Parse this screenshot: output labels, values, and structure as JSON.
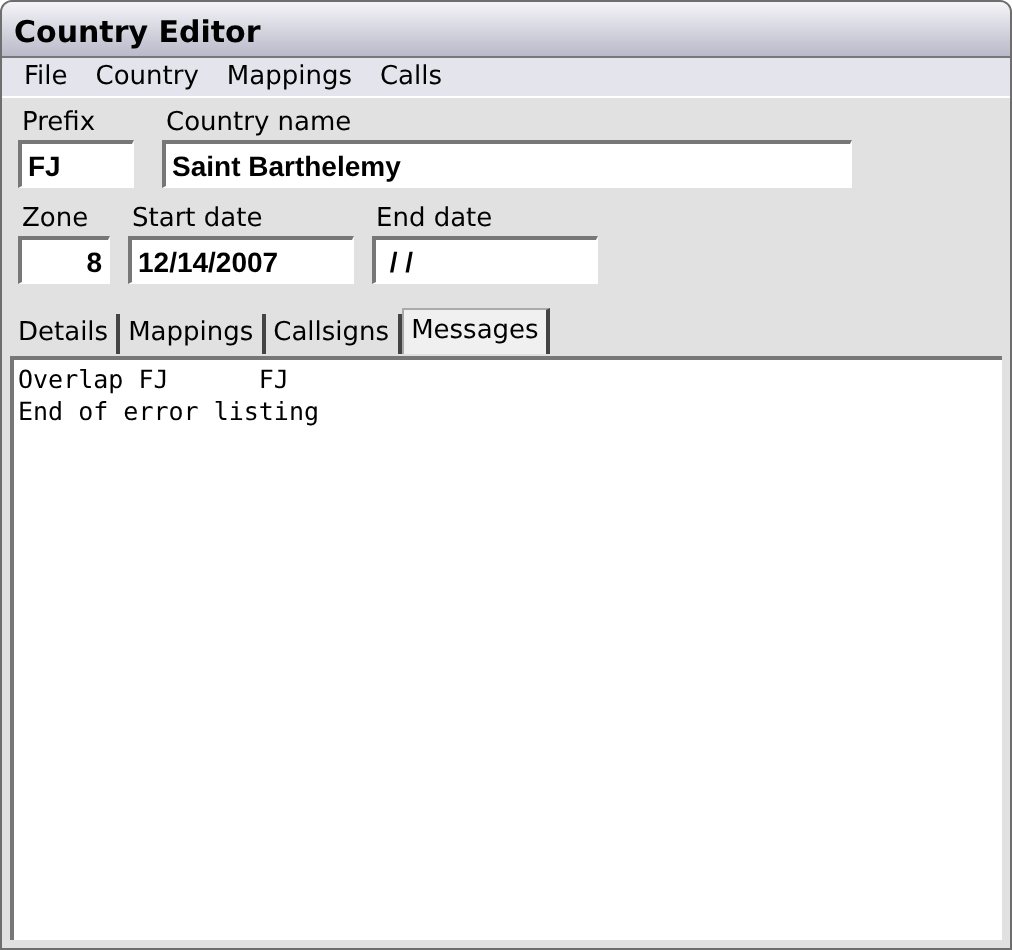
{
  "window": {
    "title": "Country Editor"
  },
  "menu": [
    "File",
    "Country",
    "Mappings",
    "Calls"
  ],
  "prefix": {
    "label": "Prefix",
    "value": "FJ"
  },
  "country_name": {
    "label": "Country name",
    "value": "Saint Barthelemy"
  },
  "zone": {
    "label": "Zone",
    "value": "8"
  },
  "start_date": {
    "label": "Start date",
    "value": "12/14/2007"
  },
  "end_date": {
    "label": "End date",
    "value": " / /"
  },
  "tabs": [
    {
      "label": "Details",
      "selected": false
    },
    {
      "label": "Mappings",
      "selected": false
    },
    {
      "label": "Callsigns",
      "selected": false
    },
    {
      "label": "Messages",
      "selected": true
    }
  ],
  "messages": [
    "Overlap FJ      FJ",
    "End of error listing"
  ]
}
